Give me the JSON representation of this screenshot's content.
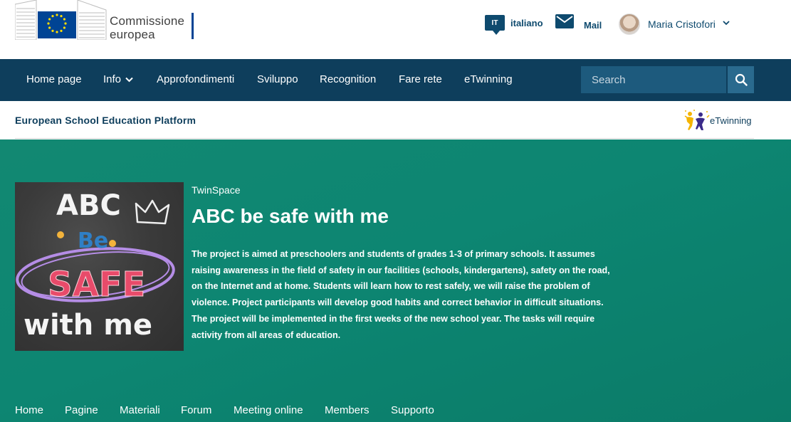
{
  "header": {
    "logo_line1": "Commissione",
    "logo_line2": "europea",
    "language_code": "IT",
    "language_label": "italiano",
    "mail_label": "Mail",
    "user_name": "Maria Cristofori"
  },
  "nav": {
    "items": [
      {
        "label": "Home page"
      },
      {
        "label": "Info"
      },
      {
        "label": "Approfondimenti"
      },
      {
        "label": "Sviluppo"
      },
      {
        "label": "Recognition"
      },
      {
        "label": "Fare rete"
      },
      {
        "label": "eTwinning"
      }
    ],
    "search_placeholder": "Search"
  },
  "subheader": {
    "platform_title": "European School Education Platform",
    "etwinning_logo_text": "eTwinning"
  },
  "hero": {
    "kicker": "TwinSpace",
    "title": "ABC be safe with me",
    "description": "The project is aimed at preschoolers and students of grades 1-3 of primary schools. It assumes raising awareness in the field of safety in our facilities (schools, kindergartens), safety on the road, on the Internet and at home. Students will learn how to rest safely, we will raise the problem of violence. Project participants will develop good habits and correct behavior in difficult situations. The project will be implemented in the first weeks of the new school year. The tasks will require activity from all areas of education.",
    "image_text": {
      "line1": "ABC",
      "line2": "Be",
      "line3": "SAFE",
      "line4": "with me"
    }
  },
  "tabs": [
    {
      "label": "Home"
    },
    {
      "label": "Pagine"
    },
    {
      "label": "Materiali"
    },
    {
      "label": "Forum"
    },
    {
      "label": "Meeting online"
    },
    {
      "label": "Members"
    },
    {
      "label": "Supporto"
    }
  ],
  "colors": {
    "nav_bg": "#0e3e5c",
    "hero_bg": "#0d8672",
    "accent_blue": "#004494"
  },
  "icons": {
    "language": "speech-bubble-icon",
    "mail": "envelope-icon",
    "user_menu": "chevron-down-icon",
    "search": "search-icon",
    "info_dropdown": "chevron-down-icon"
  }
}
